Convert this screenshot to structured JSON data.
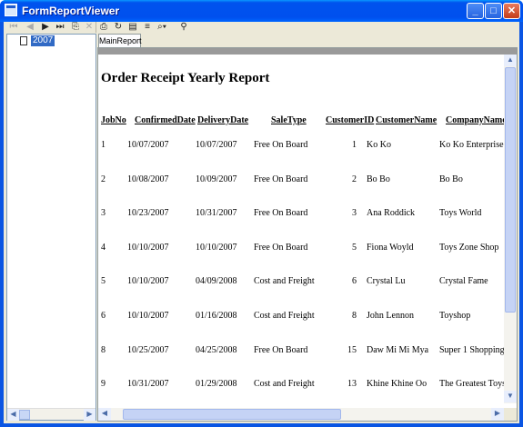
{
  "window": {
    "title": "FormReportViewer"
  },
  "toolbar": {
    "buttons": [
      "first-page",
      "previous-page",
      "next-page",
      "last-page",
      "export",
      "stop",
      "print",
      "refresh",
      "print-layout",
      "group-tree",
      "zoom",
      "find"
    ]
  },
  "tree": {
    "items": [
      {
        "label": "2007"
      }
    ]
  },
  "tab": {
    "label": "MainReport"
  },
  "report": {
    "title": "Order Receipt Yearly Report",
    "columns": [
      "JobNo",
      "ConfirmedDate",
      "DeliveryDate",
      "SaleType",
      "CustomerID",
      "CustomerName",
      "CompanyName"
    ],
    "rows": [
      {
        "job": "1",
        "confirmed": "10/07/2007",
        "delivery": "10/07/2007",
        "sale": "Free On Board",
        "cid": "1",
        "cname": "Ko Ko",
        "company": "Ko Ko Enterprise"
      },
      {
        "job": "2",
        "confirmed": "10/08/2007",
        "delivery": "10/09/2007",
        "sale": "Free On Board",
        "cid": "2",
        "cname": "Bo Bo",
        "company": "Bo Bo"
      },
      {
        "job": "3",
        "confirmed": "10/23/2007",
        "delivery": "10/31/2007",
        "sale": "Free On Board",
        "cid": "3",
        "cname": "Ana Roddick",
        "company": "Toys World"
      },
      {
        "job": "4",
        "confirmed": "10/10/2007",
        "delivery": "10/10/2007",
        "sale": "Free On Board",
        "cid": "5",
        "cname": "Fiona Woyld",
        "company": "Toys Zone Shop"
      },
      {
        "job": "5",
        "confirmed": "10/10/2007",
        "delivery": "04/09/2008",
        "sale": "Cost and Freight",
        "cid": "6",
        "cname": "Crystal Lu",
        "company": "Crystal Fame"
      },
      {
        "job": "6",
        "confirmed": "10/10/2007",
        "delivery": "01/16/2008",
        "sale": "Cost and Freight",
        "cid": "8",
        "cname": "John Lennon",
        "company": "Toyshop"
      },
      {
        "job": "8",
        "confirmed": "10/25/2007",
        "delivery": "04/25/2008",
        "sale": "Free On Board",
        "cid": "15",
        "cname": "Daw Mi Mi Mya",
        "company": "Super 1 Shopping"
      },
      {
        "job": "9",
        "confirmed": "10/31/2007",
        "delivery": "01/29/2008",
        "sale": "Cost and Freight",
        "cid": "13",
        "cname": "Khine Khine Oo",
        "company": "The Greatest Toys"
      }
    ]
  }
}
